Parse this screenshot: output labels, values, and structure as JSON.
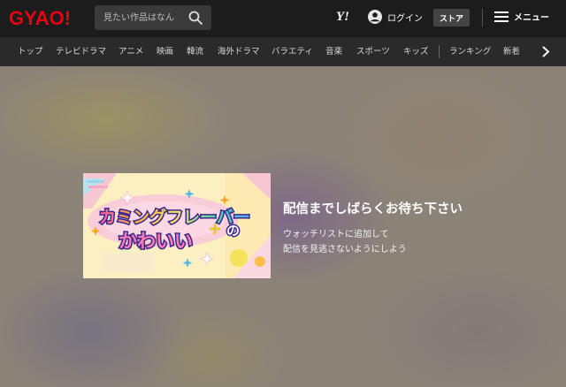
{
  "header": {
    "logo": "GYAO!",
    "search": {
      "placeholder": "見たい作品はなん"
    },
    "yj_logo": "Y!",
    "login_label": "ログイン",
    "store_label": "ストア",
    "menu_label": "メニュー"
  },
  "nav": {
    "items": [
      "トップ",
      "テレビドラマ",
      "アニメ",
      "映画",
      "韓流",
      "海外ドラマ",
      "バラエティ",
      "音楽",
      "スポーツ",
      "キッズ",
      "ランキング",
      "新着"
    ]
  },
  "player": {
    "thumbnail": {
      "title_line1": "カミングフレーバー",
      "title_line2": "かわいい",
      "title_suffix": "の"
    },
    "message_title": "配信までしばらくお待ち下さい",
    "message_lines": [
      "ウォッチリストに追加して",
      "配信を見逃さないようにしよう"
    ]
  },
  "colors": {
    "logo": "#e60012",
    "header_bg": "#1c1c1c",
    "nav_bg": "#2a2a2a"
  }
}
